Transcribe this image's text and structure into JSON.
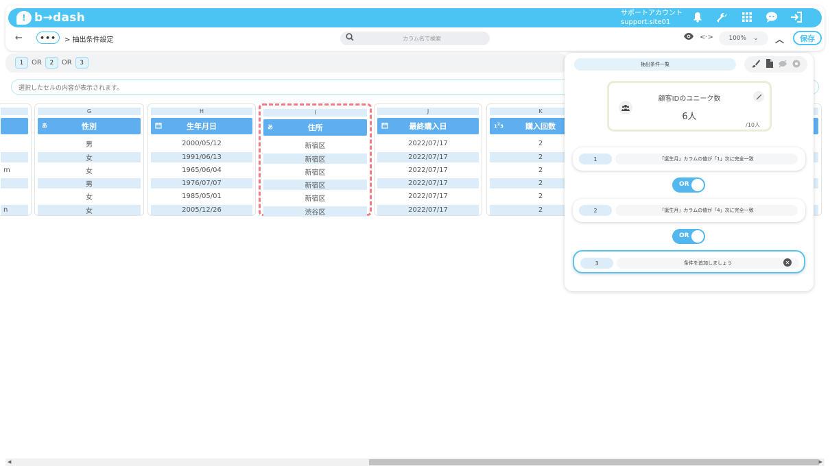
{
  "header": {
    "logo_text": "b→dash",
    "account_name": "サポートアカウント",
    "account_id": "support.site01"
  },
  "toolbar": {
    "dots_label": "•••",
    "breadcrumb": "> 抽出条件設定",
    "search_placeholder": "カラム名で検索",
    "zoom": "100%",
    "save_label": "保存"
  },
  "chips": {
    "items": [
      "1",
      "2",
      "3"
    ],
    "separator": "OR"
  },
  "cell_bar": {
    "placeholder": "選択したセルの内容が表示されます。"
  },
  "table": {
    "partial_left_cells": [
      "",
      "",
      "m",
      "",
      "",
      "n"
    ],
    "columns": [
      {
        "letter": "G",
        "name": "性別",
        "type_icon": "あ",
        "cells": [
          "男",
          "女",
          "女",
          "男",
          "女",
          "女"
        ]
      },
      {
        "letter": "H",
        "name": "生年月日",
        "type_icon": "calendar",
        "cells": [
          "2000/05/12",
          "1991/06/13",
          "1965/06/04",
          "1976/07/07",
          "1985/05/01",
          "2005/12/26"
        ]
      },
      {
        "letter": "I",
        "name": "住所",
        "type_icon": "あ",
        "cells": [
          "新宿区",
          "新宿区",
          "新宿区",
          "新宿区",
          "新宿区",
          "渋谷区"
        ]
      },
      {
        "letter": "J",
        "name": "最終購入日",
        "type_icon": "calendar",
        "cells": [
          "2022/07/17",
          "2022/07/17",
          "2022/07/17",
          "2022/07/17",
          "2022/07/17",
          "2022/07/17"
        ]
      },
      {
        "letter": "K",
        "name": "購入回数",
        "type_icon": "123",
        "cells": [
          "2",
          "2",
          "2",
          "2",
          "2",
          "2"
        ]
      }
    ]
  },
  "panel": {
    "title": "抽出条件一覧",
    "count_label": "顧客IDのユニーク数",
    "count_value": "6人",
    "count_total": "/10人",
    "conditions": [
      {
        "num": "1",
        "text": "「誕生月」カラムの値が「1」次に完全一致"
      },
      {
        "num": "2",
        "text": "「誕生月」カラムの値が「4」次に完全一致"
      },
      {
        "num": "3",
        "text": "条件を追加しましょう"
      }
    ],
    "toggle_label": "OR"
  },
  "colors": {
    "brand": "#4cc4f3",
    "column_header": "#5eaef0",
    "selection_dash": "#f07b83"
  }
}
